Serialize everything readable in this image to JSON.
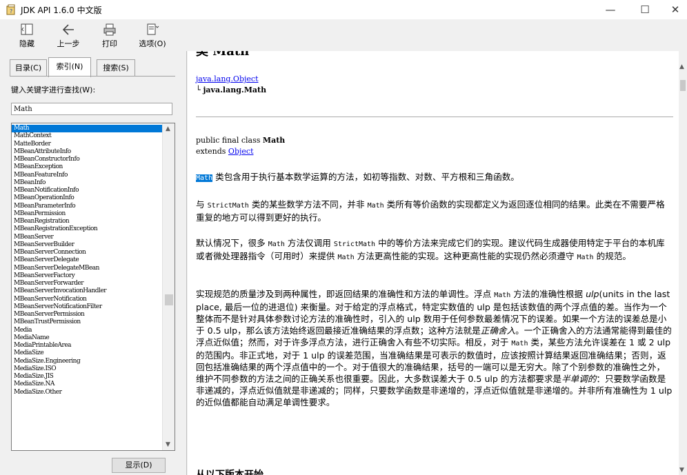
{
  "window": {
    "title": "JDK API 1.6.0 中文版",
    "minimize": "—",
    "maximize": "☐",
    "close": "✕"
  },
  "toolbar": {
    "hide": "隐藏",
    "back": "上一步",
    "print": "打印",
    "options": "选项(O)"
  },
  "tabs": {
    "contents": "目录(C)",
    "index": "索引(N)",
    "search": "搜索(S)"
  },
  "keyword": {
    "label": "键入关键字进行查找(W):",
    "value": "Math"
  },
  "index_list": [
    "Math",
    "MathContext",
    "MatteBorder",
    "MBeanAttributeInfo",
    "MBeanConstructorInfo",
    "MBeanException",
    "MBeanFeatureInfo",
    "MBeanInfo",
    "MBeanNotificationInfo",
    "MBeanOperationInfo",
    "MBeanParameterInfo",
    "MBeanPermission",
    "MBeanRegistration",
    "MBeanRegistrationException",
    "MBeanServer",
    "MBeanServerBuilder",
    "MBeanServerConnection",
    "MBeanServerDelegate",
    "MBeanServerDelegateMBean",
    "MBeanServerFactory",
    "MBeanServerForwarder",
    "MBeanServerInvocationHandler",
    "MBeanServerNotification",
    "MBeanServerNotificationFilter",
    "MBeanServerPermission",
    "MBeanTrustPermission",
    "Media",
    "MediaName",
    "MediaPrintableArea",
    "MediaSize",
    "MediaSize.Engineering",
    "MediaSize.ISO",
    "MediaSize.JIS",
    "MediaSize.NA",
    "MediaSize.Other"
  ],
  "display_button": "显示(D)",
  "content": {
    "heading": "类 Math",
    "hierarchy_root": "java.lang.Object",
    "hierarchy_child": "└ java.lang.Math",
    "decl_prefix": "public final class ",
    "decl_name": "Math",
    "extends_prefix": "extends ",
    "extends_link": "Object",
    "p1": {
      "word": "Math",
      "text": " 类包含用于执行基本数学运算的方法，如初等指数、对数、平方根和三角函数。"
    },
    "p2": {
      "a": "与 ",
      "c1": "StrictMath",
      "b": " 类的某些数学方法不同，并非 ",
      "c2": "Math",
      "d": " 类所有等价函数的实现都定义为返回逐位相同的结果。此类在不需要严格重复的地方可以得到更好的执行。"
    },
    "p3": {
      "a": "默认情况下，很多 ",
      "c1": "Math",
      "b": " 方法仅调用 ",
      "c2": "StrictMath",
      "d": " 中的等价方法来完成它们的实现。建议代码生成器使用特定于平台的本机库或者微处理器指令（可用时）来提供 ",
      "c3": "Math",
      "e": " 方法更高性能的实现。这种更高性能的实现仍然必须遵守 ",
      "c4": "Math",
      "f": " 的规范。"
    },
    "p4": {
      "a": "实现规范的质量涉及到两种属性，即返回结果的准确性和方法的单调性。浮点 ",
      "c1": "Math",
      "b": " 方法的准确性根据 ",
      "ulp": "ulp",
      "c": "(units in the last place, 最后一位的进退位) 来衡量。对于给定的浮点格式，特定实数值的 ulp 是包括该数值的两个浮点值的差。当作为一个整体而不是针对具体参数讨论方法的准确性时，引入的 ulp 数用于任何参数最差情况下的误差。如果一个方法的误差总是小于 0.5 ulp，那么该方法始终返回最接近准确结果的浮点数；这种方法就是",
      "round": "正确舍入",
      "d": "。一个正确舍入的方法通常能得到最佳的浮点近似值；然而，对于许多浮点方法，进行正确舍入有些不切实际。相反，对于 ",
      "c2": "Math",
      "e": " 类，某些方法允许误差在 1 或 2 ulp 的范围内。非正式地，对于 1 ulp 的误差范围，当准确结果是可表示的数值时，应该按照计算结果返回准确结果；否则，返回包括准确结果的两个浮点值中的一个。对于值很大的准确结果，括号的一端可以是无穷大。除了个别参数的准确性之外，维护不同参数的方法之间的正确关系也很重要。因此，大多数误差大于 0.5 ulp 的方法都要求是",
      "semi": "半单调的",
      "f": "：只要数学函数是非递减的，浮点近似值就是非递减的；同样，只要数学函数是非递增的，浮点近似值就是非递增的。并非所有准确性为 1 ulp 的近似值都能自动满足单调性要求。"
    },
    "bottom_heading": "从以下版本开始"
  }
}
